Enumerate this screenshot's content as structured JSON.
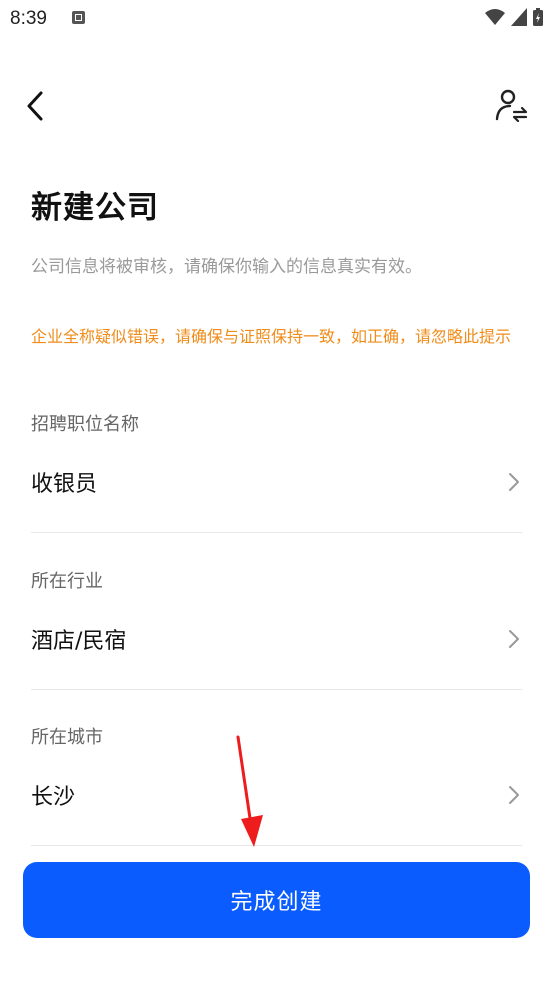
{
  "status_bar": {
    "time": "8:39",
    "icons": [
      "notification-icon",
      "wifi-icon",
      "signal-icon",
      "battery-icon"
    ]
  },
  "header": {
    "back_icon": "chevron-left-icon",
    "switch_icon": "switch-identity-icon"
  },
  "page": {
    "title": "新建公司",
    "subtitle": "公司信息将被审核，请确保你输入的信息真实有效。",
    "warning": "企业全称疑似错误，请确保与证照保持一致，如正确，请忽略此提示"
  },
  "fields": [
    {
      "label": "招聘职位名称",
      "value": "收银员"
    },
    {
      "label": "所在行业",
      "value": "酒店/民宿"
    },
    {
      "label": "所在城市",
      "value": "长沙"
    }
  ],
  "submit_label": "完成创建",
  "colors": {
    "primary": "#0a5cff",
    "warning": "#f08c1a",
    "annotation": "#ee1c1c"
  }
}
